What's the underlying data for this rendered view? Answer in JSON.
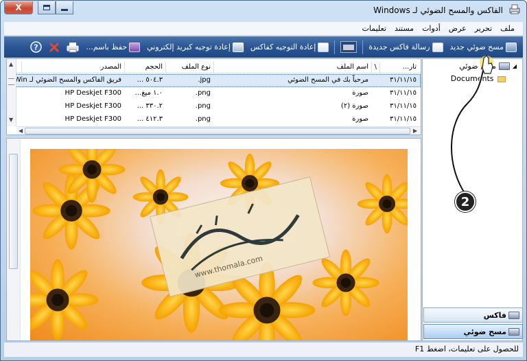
{
  "window": {
    "title": "الفاكس والمسح الضوئي لـ Windows",
    "close_glyph": "X",
    "colors": {
      "toolbar": "#2b5594",
      "accent": "#4b75ad"
    }
  },
  "menu": [
    "ملف",
    "تحرير",
    "عرض",
    "أدوات",
    "مستند",
    "تعليمات"
  ],
  "toolbar": {
    "new_scan": "مسح ضوئي جديد",
    "new_fax": "رسالة فاكس جديدة",
    "forward_fax": "إعادة التوجيه كفاكس",
    "forward_email": "إعادة توجيه كبريد إلكتروني",
    "save_as": "حفظ باسم...",
    "icons": [
      "scanner-icon",
      "fax-icon",
      "fax-forward-icon",
      "email-forward-icon",
      "save-icon",
      "print-icon",
      "delete-icon",
      "help-icon"
    ]
  },
  "tree": {
    "root": "مسح ضوئي",
    "child": "Documents"
  },
  "nav": {
    "fax": "فاكس",
    "scan": "مسح ضوئي"
  },
  "list": {
    "columns": [
      "تار...",
      "\\",
      "اسم الملف",
      "نوع الملف",
      "الحجم",
      "المصدر"
    ],
    "rows": [
      {
        "date": "٣١/١١/١٥",
        "name": "مرحباً بك في المسح الضوئي",
        "type": "jpg.",
        "size": "٥٠٤.٣ ...",
        "source": "فريق الفاكس والمسح الضوئي لـ Win..."
      },
      {
        "date": "٣١/١١/١٥",
        "name": "صورة",
        "type": "png.",
        "size": "١.٠ ميغ...",
        "source": "HP Deskjet F300"
      },
      {
        "date": "٣١/١١/١٥",
        "name": "صورة (٢)",
        "type": "png.",
        "size": "٣٣٠.٢ ...",
        "source": "HP Deskjet F300"
      },
      {
        "date": "٣١/١١/١٥",
        "name": "صورة",
        "type": "png.",
        "size": "٤١٢.٣ ...",
        "source": "HP Deskjet F300"
      }
    ]
  },
  "preview": {
    "watermark": "www.thomala.com"
  },
  "status": "للحصول على تعليمات، اضغط F1",
  "callout": "2"
}
